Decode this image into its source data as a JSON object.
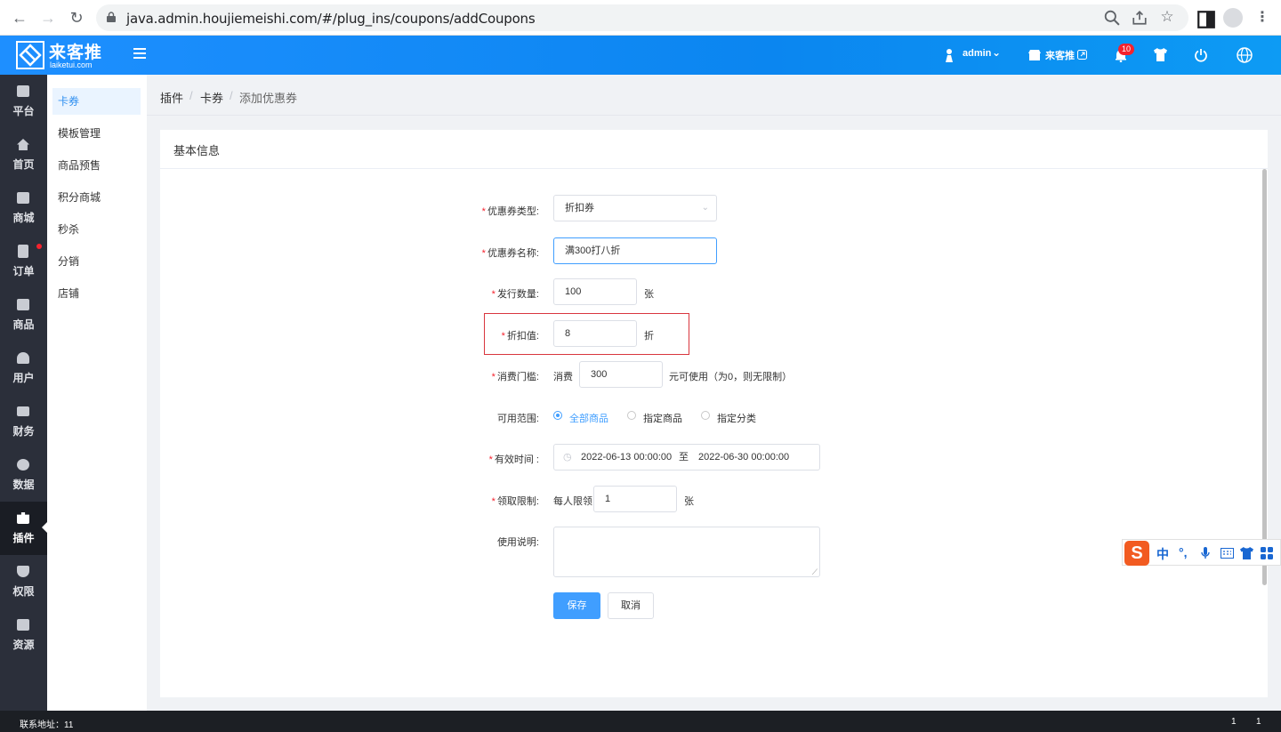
{
  "browser": {
    "url": "java.admin.houjiemeishi.com/#/plug_ins/coupons/addCoupons"
  },
  "header": {
    "logo_text": "来客推",
    "logo_sub": "laiketui.com",
    "user": "admin",
    "shop_link": "来客推",
    "notification_count": "10"
  },
  "sidebar": {
    "items": [
      {
        "label": "平台",
        "icon": "platform-icon"
      },
      {
        "label": "首页",
        "icon": "home-icon"
      },
      {
        "label": "商城",
        "icon": "store-icon"
      },
      {
        "label": "订单",
        "icon": "order-icon"
      },
      {
        "label": "商品",
        "icon": "goods-icon"
      },
      {
        "label": "用户",
        "icon": "user-icon"
      },
      {
        "label": "财务",
        "icon": "wallet-icon"
      },
      {
        "label": "数据",
        "icon": "pie-chart-icon"
      },
      {
        "label": "插件",
        "icon": "puzzle-icon"
      },
      {
        "label": "权限",
        "icon": "shield-icon"
      },
      {
        "label": "资源",
        "icon": "image-icon"
      }
    ]
  },
  "submenu": {
    "items": [
      "卡券",
      "模板管理",
      "商品预售",
      "积分商城",
      "秒杀",
      "分销",
      "店铺"
    ]
  },
  "breadcrumb": {
    "level1": "插件",
    "sep": "/",
    "level2": "卡券",
    "level3": "添加优惠券"
  },
  "card": {
    "title": "基本信息"
  },
  "form": {
    "type_label": "优惠券类型:",
    "type_value": "折扣券",
    "name_label": "优惠券名称:",
    "name_value": "满300打八折",
    "qty_label": "发行数量:",
    "qty_value": "100",
    "qty_unit": "张",
    "discount_label": "折扣值:",
    "discount_value": "8",
    "discount_unit": "折",
    "threshold_label": "消费门槛:",
    "threshold_prefix": "消费",
    "threshold_value": "300",
    "threshold_suffix": "元可使用（为0，则无限制）",
    "scope_label": "可用范围:",
    "scope_options": [
      "全部商品",
      "指定商品",
      "指定分类"
    ],
    "scope_selected": "全部商品",
    "time_label": "有效时间 :",
    "time_start": "2022-06-13 00:00:00",
    "time_sep": "至",
    "time_end": "2022-06-30 00:00:00",
    "limit_label": "领取限制:",
    "limit_prefix": "每人限领",
    "limit_value": "1",
    "limit_unit": "张",
    "desc_label": "使用说明:",
    "save": "保存",
    "cancel": "取消"
  },
  "ime": {
    "logo": "S",
    "lang": "中",
    "punct": "°,"
  },
  "footer": {
    "contact": "联系地址：11",
    "right1": "1",
    "right2": "1"
  }
}
